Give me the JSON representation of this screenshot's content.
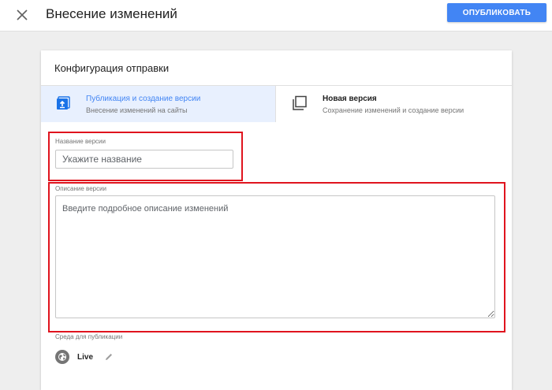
{
  "header": {
    "title": "Внесение изменений",
    "publish_label": "ОПУБЛИКОВАТЬ",
    "close_icon": "close-icon"
  },
  "config": {
    "title": "Конфигурация отправки",
    "tabs": [
      {
        "title": "Публикация и создание версии",
        "subtitle": "Внесение изменений на сайты",
        "icon": "publish-upload-icon",
        "selected": true
      },
      {
        "title": "Новая версия",
        "subtitle": "Сохранение изменений и создание версии",
        "icon": "new-version-icon",
        "selected": false
      }
    ]
  },
  "form": {
    "version_name_label": "Название версии",
    "version_name_placeholder": "Укажите название",
    "version_name_value": "",
    "version_desc_label": "Описание версии",
    "version_desc_placeholder": "Введите подробное описание изменений",
    "version_desc_value": ""
  },
  "environment": {
    "label": "Среда для публикации",
    "name": "Live",
    "icon": "globe-icon",
    "edit_icon": "pencil-icon"
  },
  "colors": {
    "accent": "#4285f4",
    "selected_tab_bg": "#e8f0fe",
    "highlight": "#e0141e"
  }
}
